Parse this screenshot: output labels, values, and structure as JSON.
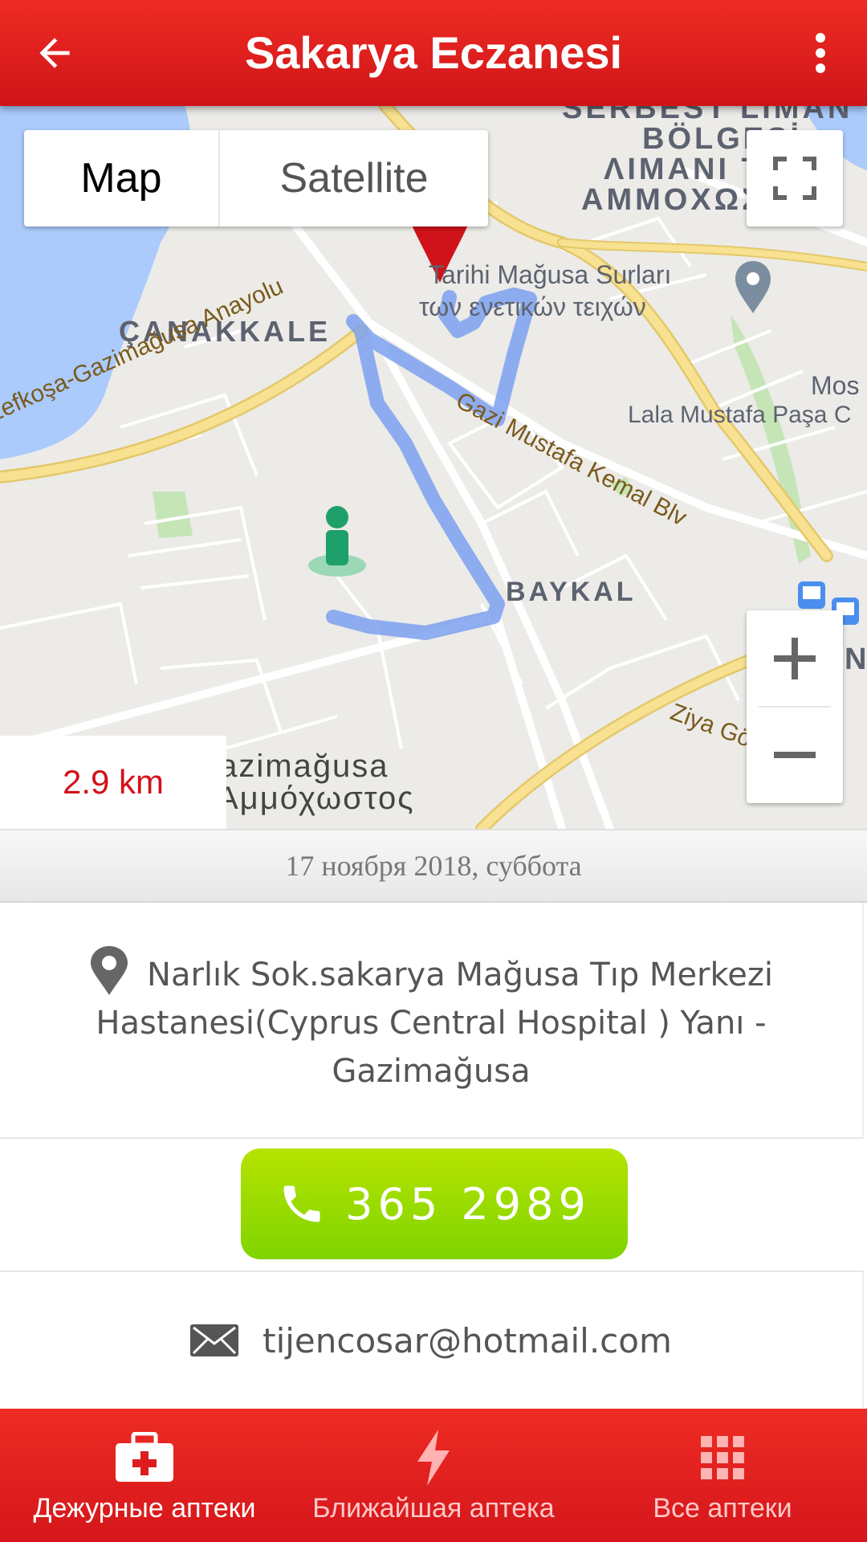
{
  "header": {
    "title": "Sakarya Eczanesi",
    "back_icon": "arrow-left-icon",
    "menu_icon": "more-vert-icon",
    "color": "#dc1d1f"
  },
  "map": {
    "type_control": {
      "map_label": "Map",
      "satellite_label": "Satellite",
      "selected": "Map"
    },
    "distance": "2.9 km",
    "labels": {
      "serbest_1": "SERBEST LİMAN",
      "serbest_2": "BÖLGESİ",
      "greek_1": "ΛΙΜΑΝΙ ΤΗΣ",
      "greek_2": "ΑΜΜΟΧΩΣΤΟΥ",
      "surlar_1": "Tarihi Mağusa Surları",
      "surlar_2": "των ενετικών τειχών",
      "canakkale": "ÇANAKKALE",
      "anayolu": "Lefkoşa-Gazimağusa Anayolu",
      "kemal_blv": "Gazi Mustafa Kemal Blv",
      "lala": "Lala Mustafa Paşa C",
      "mosq": "Mos",
      "baykal": "BAYKAL",
      "ziya": "Ziya Gö",
      "city_1": "Gazimağusa",
      "city_2": "Αμμόχωστος",
      "edge_n": "N"
    },
    "route_color": "#7da1f0"
  },
  "date": "17 ноября 2018, суббота",
  "address": "Narlık Sok.sakarya Mağusa Tıp Merkezi Hastanesi(Cyprus Central Hospital ) Yanı - Gazimağusa",
  "phone": "365 2989",
  "email": "tijencosar@hotmail.com",
  "bottom_nav": [
    {
      "label": "Дежурные аптеки",
      "icon": "first-aid-kit-icon",
      "active": true
    },
    {
      "label": "Ближайшая аптека",
      "icon": "lightning-icon",
      "active": false
    },
    {
      "label": "Все аптеки",
      "icon": "grid-icon",
      "active": false
    }
  ]
}
